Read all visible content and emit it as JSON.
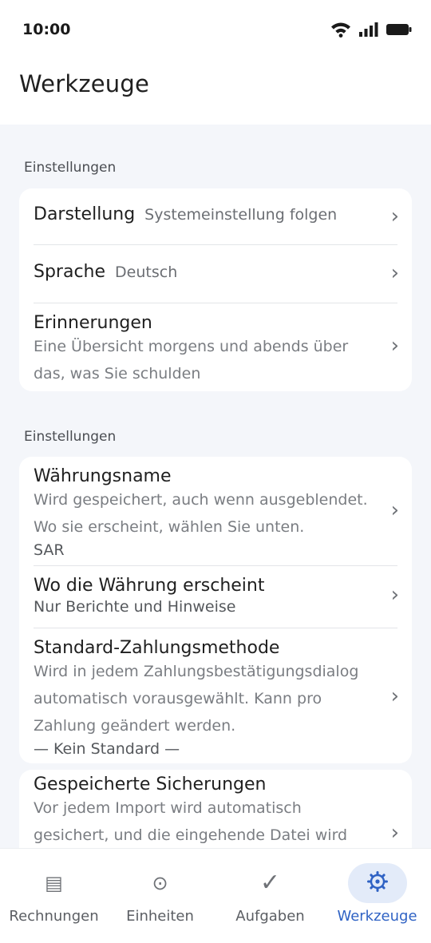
{
  "status_bar": {
    "time": "10:00",
    "icons": [
      "wifi-icon",
      "signal-icon",
      "battery-icon"
    ]
  },
  "app_bar": {
    "title": "Werkzeuge"
  },
  "sections": [
    {
      "header": "Einstellungen",
      "items": [
        {
          "title": "Darstellung",
          "value": "Systemeinstellung folgen"
        },
        {
          "title": "Sprache",
          "value": "Deutsch"
        },
        {
          "title": "Erinnerungen",
          "subtitle_lines": [
            "Eine Übersicht morgens und abends über",
            "das, was Sie schulden"
          ]
        }
      ]
    },
    {
      "header": "Einstellungen",
      "items": [
        {
          "title": "Währungsname",
          "subtitle_lines": [
            "Wird gespeichert, auch wenn ausgeblendet.",
            "Wo sie erscheint, wählen Sie unten."
          ],
          "extra": "SAR"
        },
        {
          "title": "Wo die Währung erscheint",
          "subtitle_lines": [
            "Nur Berichte und Hinweise"
          ]
        },
        {
          "title": "Standard-Zahlungsmethode",
          "subtitle_lines": [
            "Wird in jedem Zahlungsbestätigungsdialog",
            "automatisch vorausgewählt. Kann pro",
            "Zahlung geändert werden."
          ],
          "extra": "— Kein Standard —"
        }
      ]
    },
    {
      "items": [
        {
          "title": "Gespeicherte Sicherungen",
          "subtitle_lines": [
            "Vor jedem Import wird automatisch",
            "gesichert, und die eingehende Datei wird"
          ]
        }
      ]
    }
  ],
  "chevron": "›",
  "bottom_nav": {
    "items": [
      {
        "label": "Rechnungen",
        "icon": "list-icon",
        "glyph": "▤",
        "active": false
      },
      {
        "label": "Einheiten",
        "icon": "units-icon",
        "glyph": "⊙",
        "active": false
      },
      {
        "label": "Aufgaben",
        "icon": "check-icon",
        "glyph": "✓",
        "active": false
      },
      {
        "label": "Werkzeuge",
        "icon": "gear-icon",
        "glyph": "⚙",
        "active": true
      }
    ]
  },
  "colors": {
    "accent": "#2f62c4",
    "active_pill": "#e3ebf9",
    "content_bg": "#f4f6fa",
    "card_bg": "#ffffff"
  }
}
